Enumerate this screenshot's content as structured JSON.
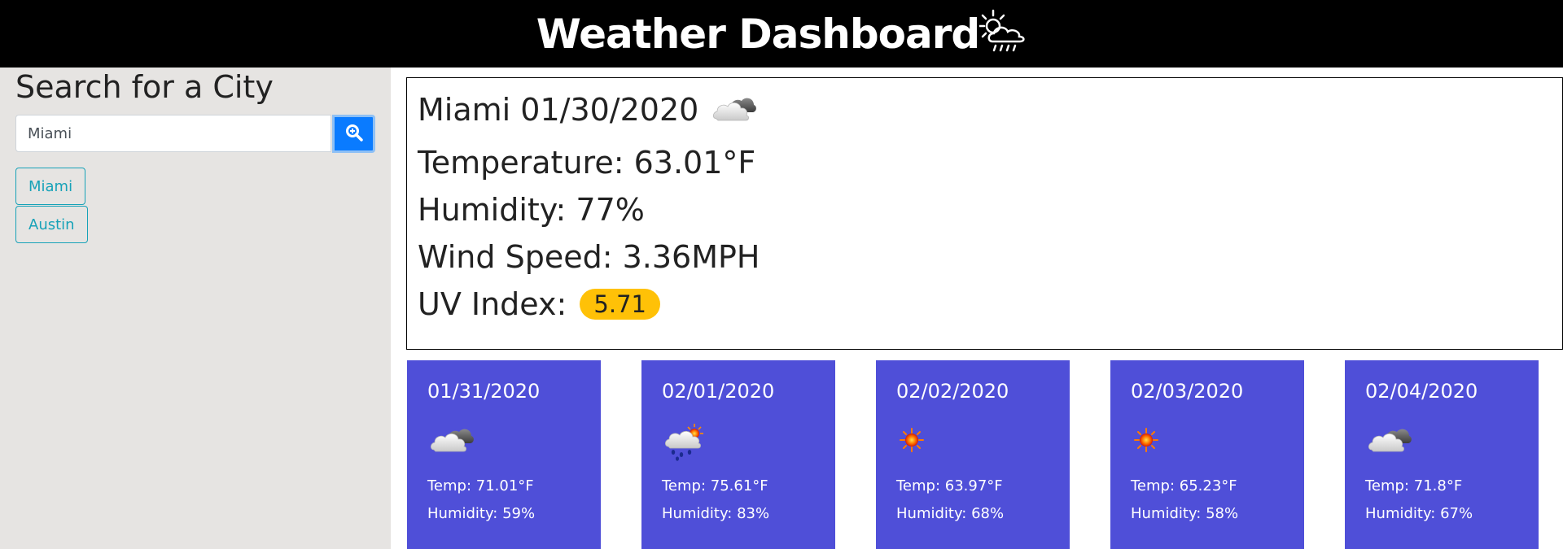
{
  "header": {
    "title": "Weather Dashboard",
    "icon": "sun-behind-rain-cloud-icon"
  },
  "sidebar": {
    "heading": "Search for a City",
    "search": {
      "value": "Miami",
      "placeholder": "",
      "button_icon": "search-icon"
    },
    "history": [
      "Miami",
      "Austin"
    ]
  },
  "current": {
    "city_date": "Miami 01/30/2020",
    "icon": "partly-cloudy-icon",
    "temperature": "Temperature: 63.01°F",
    "humidity": "Humidity: 77%",
    "wind": "Wind Speed: 3.36MPH",
    "uv_label": "UV Index:",
    "uv_value": "5.71",
    "uv_color": "#ffc107"
  },
  "forecast": [
    {
      "date": "01/31/2020",
      "icon": "partly-cloudy-icon",
      "temp": "Temp: 71.01°F",
      "humidity": "Humidity: 59%"
    },
    {
      "date": "02/01/2020",
      "icon": "rain-sun-icon",
      "temp": "Temp: 75.61°F",
      "humidity": "Humidity: 83%"
    },
    {
      "date": "02/02/2020",
      "icon": "sun-icon",
      "temp": "Temp: 63.97°F",
      "humidity": "Humidity: 68%"
    },
    {
      "date": "02/03/2020",
      "icon": "sun-icon",
      "temp": "Temp: 65.23°F",
      "humidity": "Humidity: 58%"
    },
    {
      "date": "02/04/2020",
      "icon": "partly-cloudy-icon",
      "temp": "Temp: 71.8°F",
      "humidity": "Humidity: 67%"
    }
  ],
  "colors": {
    "header_bg": "#000000",
    "sidebar_bg": "#e6e4e2",
    "search_button": "#0a7bff",
    "history_button": "#17a2b8",
    "forecast_card": "#4f4fd8"
  }
}
